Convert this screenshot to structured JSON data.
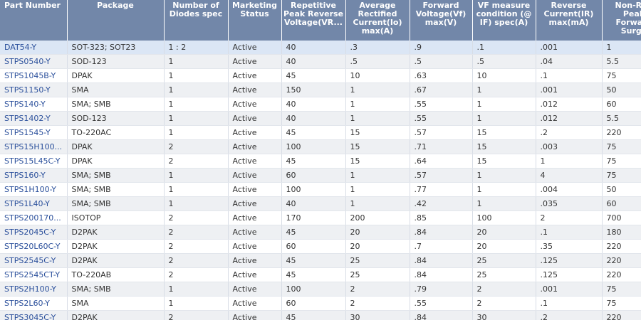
{
  "table": {
    "headers": [
      "Part Number",
      "Package",
      "Number of Diodes spec",
      "Marketing Status",
      "Repetitive Peak Reverse Voltage(VR...",
      "Average Rectified Current(Io) max(A)",
      "Forward Voltage(Vf) max(V)",
      "VF measure condition (@ IF) spec(A)",
      "Reverse Current(IR) max(mA)",
      "Non-Rep Peak Forward Surge"
    ],
    "rows": [
      [
        "DAT54-Y",
        "SOT-323; SOT23",
        "1 : 2",
        "Active",
        "40",
        ".3",
        ".9",
        ".1",
        ".001",
        "1"
      ],
      [
        "STPS0540-Y",
        "SOD-123",
        "1",
        "Active",
        "40",
        ".5",
        ".5",
        ".5",
        ".04",
        "5.5"
      ],
      [
        "STPS1045B-Y",
        "DPAK",
        "1",
        "Active",
        "45",
        "10",
        ".63",
        "10",
        ".1",
        "75"
      ],
      [
        "STPS1150-Y",
        "SMA",
        "1",
        "Active",
        "150",
        "1",
        ".67",
        "1",
        ".001",
        "50"
      ],
      [
        "STPS140-Y",
        "SMA; SMB",
        "1",
        "Active",
        "40",
        "1",
        ".55",
        "1",
        ".012",
        "60"
      ],
      [
        "STPS1402-Y",
        "SOD-123",
        "1",
        "Active",
        "40",
        "1",
        ".55",
        "1",
        ".012",
        "5.5"
      ],
      [
        "STPS1545-Y",
        "TO-220AC",
        "1",
        "Active",
        "45",
        "15",
        ".57",
        "15",
        ".2",
        "220"
      ],
      [
        "STPS15H100...",
        "DPAK",
        "2",
        "Active",
        "100",
        "15",
        ".71",
        "15",
        ".003",
        "75"
      ],
      [
        "STPS15L45C-Y",
        "DPAK",
        "2",
        "Active",
        "45",
        "15",
        ".64",
        "15",
        "1",
        "75"
      ],
      [
        "STPS160-Y",
        "SMA; SMB",
        "1",
        "Active",
        "60",
        "1",
        ".57",
        "1",
        "4",
        "75"
      ],
      [
        "STPS1H100-Y",
        "SMA; SMB",
        "1",
        "Active",
        "100",
        "1",
        ".77",
        "1",
        ".004",
        "50"
      ],
      [
        "STPS1L40-Y",
        "SMA; SMB",
        "1",
        "Active",
        "40",
        "1",
        ".42",
        "1",
        ".035",
        "60"
      ],
      [
        "STPS200170...",
        "ISOTOP",
        "2",
        "Active",
        "170",
        "200",
        ".85",
        "100",
        "2",
        "700"
      ],
      [
        "STPS2045C-Y",
        "D2PAK",
        "2",
        "Active",
        "45",
        "20",
        ".84",
        "20",
        ".1",
        "180"
      ],
      [
        "STPS20L60C-Y",
        "D2PAK",
        "2",
        "Active",
        "60",
        "20",
        ".7",
        "20",
        ".35",
        "220"
      ],
      [
        "STPS2545C-Y",
        "D2PAK",
        "2",
        "Active",
        "45",
        "25",
        ".84",
        "25",
        ".125",
        "220"
      ],
      [
        "STPS2545CT-Y",
        "TO-220AB",
        "2",
        "Active",
        "45",
        "25",
        ".84",
        "25",
        ".125",
        "220"
      ],
      [
        "STPS2H100-Y",
        "SMA; SMB",
        "1",
        "Active",
        "100",
        "2",
        ".79",
        "2",
        ".001",
        "75"
      ],
      [
        "STPS2L60-Y",
        "SMA",
        "1",
        "Active",
        "60",
        "2",
        ".55",
        "2",
        ".1",
        "75"
      ],
      [
        "STPS3045C-Y",
        "D2PAK",
        "2",
        "Active",
        "45",
        "30",
        ".84",
        "30",
        ".2",
        "220"
      ]
    ],
    "selected_row": 0
  },
  "colors": {
    "header_bg": "#7287a9",
    "selected_row_bg": "#dbe6f5",
    "link": "#2a4f9b"
  }
}
